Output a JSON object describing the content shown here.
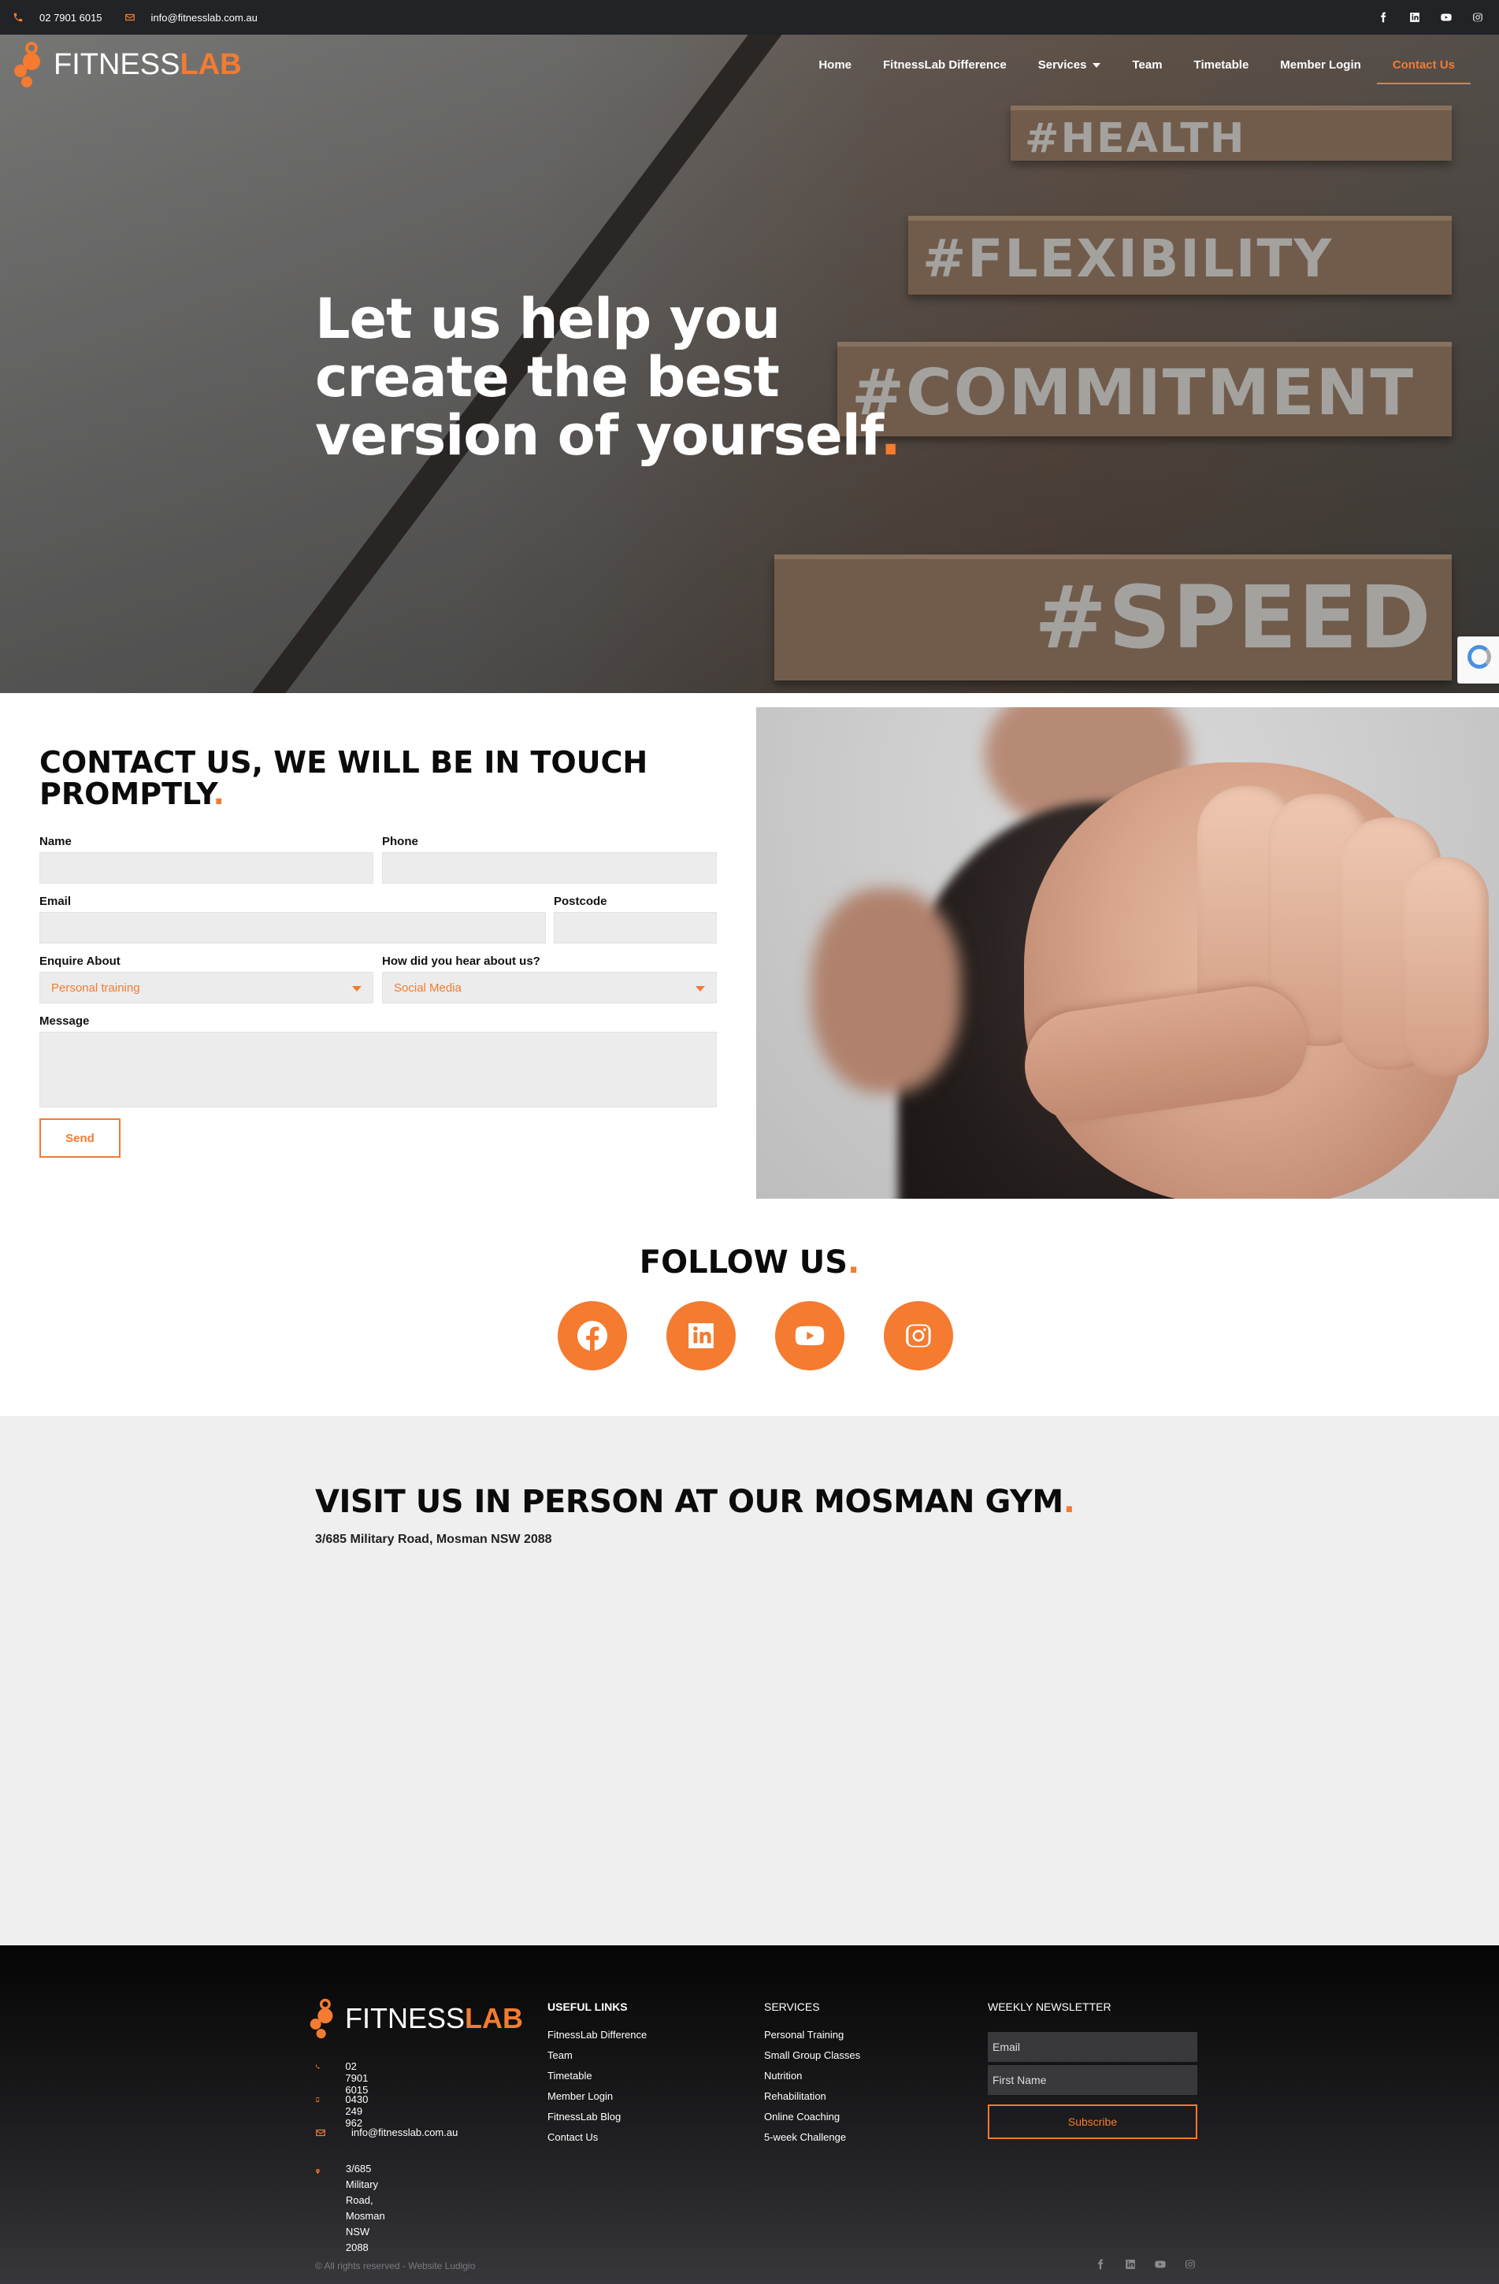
{
  "topbar": {
    "phone": "02 7901 6015",
    "email": "info@fitnesslab.com.au",
    "socials": [
      "facebook-icon",
      "linkedin-icon",
      "youtube-icon",
      "instagram-icon"
    ]
  },
  "brand": {
    "name_light": "FITNESS",
    "name_bold": "LAB",
    "accent": "#f47b30"
  },
  "nav": {
    "items": [
      "Home",
      "FitnessLab Difference",
      "Services",
      "Team",
      "Timetable",
      "Member Login",
      "Contact Us"
    ],
    "active": "Contact Us"
  },
  "hero": {
    "title": "Let us help you create the best version of yourself",
    "title_dot": ".",
    "stair_tags": [
      "#HEALTH",
      "#FLEXIBILITY",
      "#COMMITMENT",
      "#SPEED"
    ]
  },
  "contact": {
    "heading": "CONTACT US, WE WILL BE IN TOUCH PROMPTLY",
    "heading_dot": ".",
    "labels": {
      "name": "Name",
      "phone": "Phone",
      "email": "Email",
      "postcode": "Postcode",
      "enquire": "Enquire About",
      "hear": "How did you hear about us?",
      "message": "Message"
    },
    "enquire_value": "Personal training",
    "hear_value": "Social Media",
    "send": "Send"
  },
  "follow": {
    "heading": "FOLLOW US",
    "heading_dot": ".",
    "icons": [
      "facebook-icon",
      "linkedin-icon",
      "youtube-icon",
      "instagram-icon"
    ]
  },
  "visit": {
    "heading": "VISIT US IN PERSON AT OUR MOSMAN GYM",
    "heading_dot": ".",
    "address": "3/685 Military Road, Mosman NSW 2088"
  },
  "footer": {
    "phone1": "02 7901 6015",
    "phone2": "0430 249 962",
    "email": "info@fitnesslab.com.au",
    "address_line1": "3/685 Military Road,",
    "address_line2": "Mosman NSW 2088",
    "useful_links": {
      "heading": "USEFUL LINKS",
      "items": [
        "FitnessLab Difference",
        "Team",
        "Timetable",
        "Member Login",
        "FitnessLab Blog",
        "Contact Us"
      ]
    },
    "services": {
      "heading": "SERVICES",
      "items": [
        "Personal Training",
        "Small Group Classes",
        "Nutrition",
        "Rehabilitation",
        "Online Coaching",
        "5-week Challenge"
      ]
    },
    "newsletter": {
      "heading": "WEEKLY NEWSLETTER",
      "email_placeholder": "Email",
      "first_name_placeholder": "First Name",
      "subscribe": "Subscribe"
    },
    "copyright": "© All rights reserved - Website Ludigio"
  }
}
